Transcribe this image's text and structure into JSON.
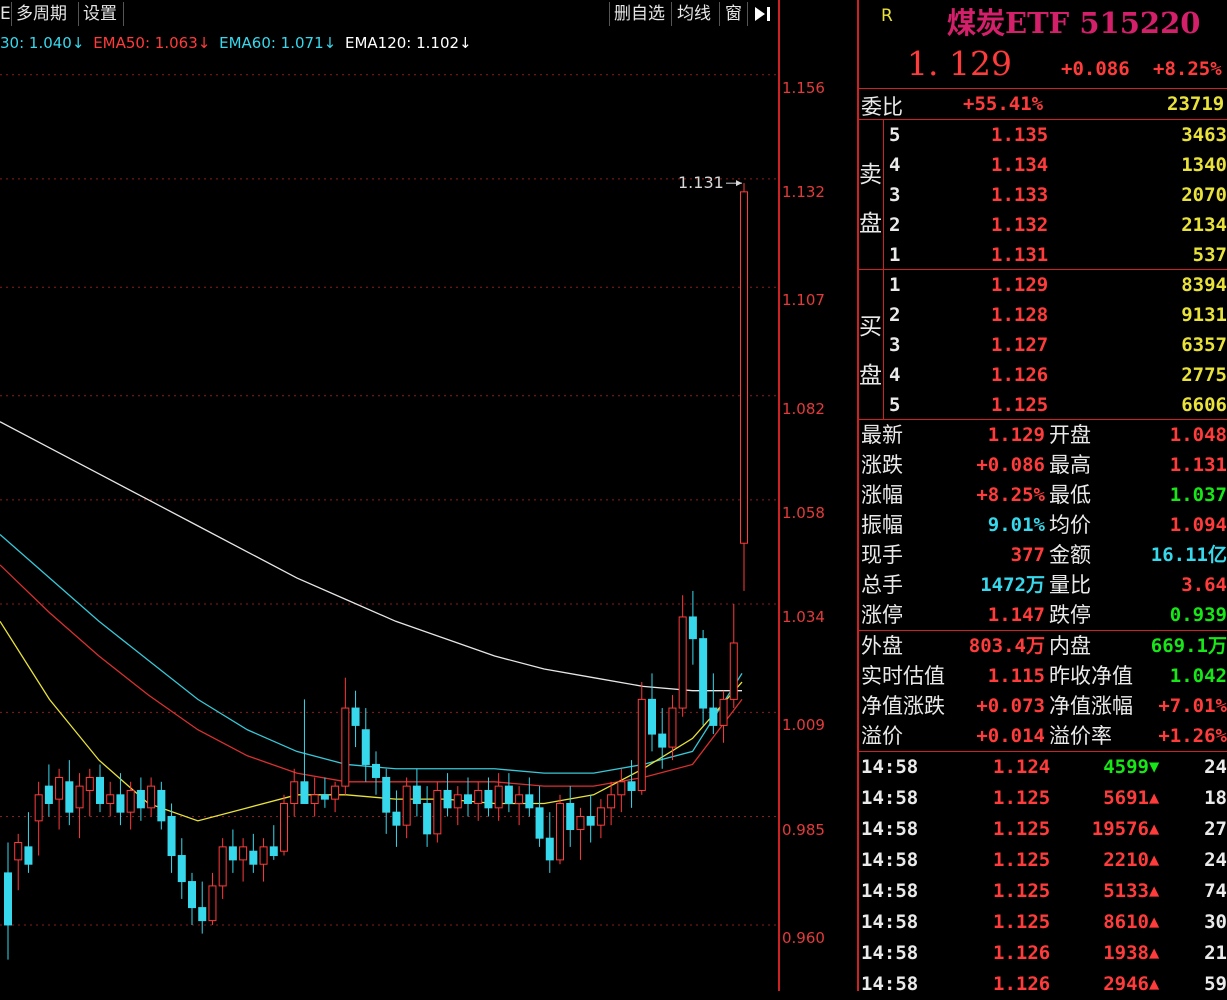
{
  "toolbar": {
    "left_items": [
      "E",
      "多周期",
      "设置"
    ],
    "right_items": [
      "删自选",
      "均线",
      "窗"
    ],
    "collapse_icon": "collapse-right-icon"
  },
  "legend": [
    {
      "text": "30: 1.040↓",
      "color": "#37d8ec"
    },
    {
      "text": "EMA50: 1.063↓",
      "color": "#ff3b3b"
    },
    {
      "text": "EMA60: 1.071↓",
      "color": "#37d8ec"
    },
    {
      "text": "EMA120: 1.102↓",
      "color": "#ffffff"
    }
  ],
  "colors": {
    "up": "#ff3b3b",
    "down": "#37d8ec",
    "ema_white": "#e6e6e6",
    "ema_cyan": "#37c8d8",
    "ema_red": "#d83030",
    "ema_yellow": "#e8e23a",
    "ema_blue": "#3a5ce8",
    "ema_green": "#2aa02a"
  },
  "chart_data": {
    "type": "candlestick",
    "ylim": [
      0.948,
      1.17
    ],
    "y_ticks": [
      "1.156",
      "1.132",
      "1.107",
      "1.082",
      "1.058",
      "1.034",
      "1.009",
      "0.985",
      "0.960"
    ],
    "y_tick_values": [
      1.156,
      1.132,
      1.107,
      1.082,
      1.058,
      1.034,
      1.009,
      0.985,
      0.96
    ],
    "high_marker": "1.131",
    "candles": [
      {
        "o": 0.972,
        "h": 0.979,
        "l": 0.952,
        "c": 0.96
      },
      {
        "o": 0.975,
        "h": 0.981,
        "l": 0.968,
        "c": 0.979
      },
      {
        "o": 0.978,
        "h": 0.986,
        "l": 0.972,
        "c": 0.974
      },
      {
        "o": 0.984,
        "h": 0.993,
        "l": 0.976,
        "c": 0.99
      },
      {
        "o": 0.992,
        "h": 0.997,
        "l": 0.985,
        "c": 0.988
      },
      {
        "o": 0.989,
        "h": 0.996,
        "l": 0.982,
        "c": 0.994
      },
      {
        "o": 0.993,
        "h": 0.998,
        "l": 0.983,
        "c": 0.986
      },
      {
        "o": 0.987,
        "h": 0.995,
        "l": 0.98,
        "c": 0.992
      },
      {
        "o": 0.991,
        "h": 0.996,
        "l": 0.985,
        "c": 0.994
      },
      {
        "o": 0.994,
        "h": 0.997,
        "l": 0.986,
        "c": 0.988
      },
      {
        "o": 0.988,
        "h": 0.993,
        "l": 0.985,
        "c": 0.99
      },
      {
        "o": 0.99,
        "h": 0.995,
        "l": 0.983,
        "c": 0.986
      },
      {
        "o": 0.986,
        "h": 0.993,
        "l": 0.982,
        "c": 0.991
      },
      {
        "o": 0.991,
        "h": 0.994,
        "l": 0.984,
        "c": 0.987
      },
      {
        "o": 0.987,
        "h": 0.994,
        "l": 0.985,
        "c": 0.992
      },
      {
        "o": 0.991,
        "h": 0.993,
        "l": 0.982,
        "c": 0.984
      },
      {
        "o": 0.985,
        "h": 0.988,
        "l": 0.972,
        "c": 0.976
      },
      {
        "o": 0.976,
        "h": 0.98,
        "l": 0.966,
        "c": 0.97
      },
      {
        "o": 0.97,
        "h": 0.972,
        "l": 0.96,
        "c": 0.964
      },
      {
        "o": 0.964,
        "h": 0.97,
        "l": 0.958,
        "c": 0.961
      },
      {
        "o": 0.961,
        "h": 0.972,
        "l": 0.96,
        "c": 0.969
      },
      {
        "o": 0.969,
        "h": 0.98,
        "l": 0.966,
        "c": 0.978
      },
      {
        "o": 0.978,
        "h": 0.982,
        "l": 0.972,
        "c": 0.975
      },
      {
        "o": 0.975,
        "h": 0.98,
        "l": 0.97,
        "c": 0.978
      },
      {
        "o": 0.977,
        "h": 0.981,
        "l": 0.972,
        "c": 0.974
      },
      {
        "o": 0.974,
        "h": 0.98,
        "l": 0.97,
        "c": 0.978
      },
      {
        "o": 0.978,
        "h": 0.983,
        "l": 0.975,
        "c": 0.976
      },
      {
        "o": 0.977,
        "h": 0.99,
        "l": 0.976,
        "c": 0.988
      },
      {
        "o": 0.988,
        "h": 0.996,
        "l": 0.985,
        "c": 0.993
      },
      {
        "o": 0.993,
        "h": 1.012,
        "l": 0.99,
        "c": 0.988
      },
      {
        "o": 0.988,
        "h": 0.994,
        "l": 0.985,
        "c": 0.99
      },
      {
        "o": 0.99,
        "h": 0.994,
        "l": 0.987,
        "c": 0.989
      },
      {
        "o": 0.989,
        "h": 0.993,
        "l": 0.986,
        "c": 0.992
      },
      {
        "o": 0.992,
        "h": 1.017,
        "l": 0.99,
        "c": 1.01
      },
      {
        "o": 1.01,
        "h": 1.014,
        "l": 1.001,
        "c": 1.006
      },
      {
        "o": 1.005,
        "h": 1.01,
        "l": 0.993,
        "c": 0.997
      },
      {
        "o": 0.997,
        "h": 1.0,
        "l": 0.99,
        "c": 0.994
      },
      {
        "o": 0.994,
        "h": 0.996,
        "l": 0.981,
        "c": 0.986
      },
      {
        "o": 0.986,
        "h": 0.991,
        "l": 0.978,
        "c": 0.983
      },
      {
        "o": 0.983,
        "h": 0.994,
        "l": 0.98,
        "c": 0.992
      },
      {
        "o": 0.992,
        "h": 0.996,
        "l": 0.985,
        "c": 0.988
      },
      {
        "o": 0.988,
        "h": 0.992,
        "l": 0.978,
        "c": 0.981
      },
      {
        "o": 0.981,
        "h": 0.993,
        "l": 0.979,
        "c": 0.991
      },
      {
        "o": 0.991,
        "h": 0.995,
        "l": 0.985,
        "c": 0.987
      },
      {
        "o": 0.987,
        "h": 0.992,
        "l": 0.983,
        "c": 0.99
      },
      {
        "o": 0.99,
        "h": 0.994,
        "l": 0.985,
        "c": 0.988
      },
      {
        "o": 0.988,
        "h": 0.993,
        "l": 0.984,
        "c": 0.991
      },
      {
        "o": 0.991,
        "h": 0.994,
        "l": 0.985,
        "c": 0.987
      },
      {
        "o": 0.987,
        "h": 0.995,
        "l": 0.984,
        "c": 0.992
      },
      {
        "o": 0.992,
        "h": 0.995,
        "l": 0.986,
        "c": 0.988
      },
      {
        "o": 0.988,
        "h": 0.992,
        "l": 0.983,
        "c": 0.99
      },
      {
        "o": 0.99,
        "h": 0.994,
        "l": 0.985,
        "c": 0.987
      },
      {
        "o": 0.987,
        "h": 0.992,
        "l": 0.978,
        "c": 0.98
      },
      {
        "o": 0.98,
        "h": 0.986,
        "l": 0.972,
        "c": 0.975
      },
      {
        "o": 0.975,
        "h": 0.99,
        "l": 0.974,
        "c": 0.988
      },
      {
        "o": 0.988,
        "h": 0.992,
        "l": 0.978,
        "c": 0.982
      },
      {
        "o": 0.982,
        "h": 0.987,
        "l": 0.975,
        "c": 0.985
      },
      {
        "o": 0.985,
        "h": 0.99,
        "l": 0.979,
        "c": 0.983
      },
      {
        "o": 0.983,
        "h": 0.989,
        "l": 0.98,
        "c": 0.987
      },
      {
        "o": 0.987,
        "h": 0.993,
        "l": 0.983,
        "c": 0.99
      },
      {
        "o": 0.99,
        "h": 0.996,
        "l": 0.986,
        "c": 0.993
      },
      {
        "o": 0.993,
        "h": 0.998,
        "l": 0.987,
        "c": 0.991
      },
      {
        "o": 0.991,
        "h": 1.016,
        "l": 0.99,
        "c": 1.012
      },
      {
        "o": 1.012,
        "h": 1.018,
        "l": 1.0,
        "c": 1.004
      },
      {
        "o": 1.004,
        "h": 1.01,
        "l": 0.996,
        "c": 1.001
      },
      {
        "o": 1.001,
        "h": 1.013,
        "l": 0.998,
        "c": 1.01
      },
      {
        "o": 1.01,
        "h": 1.036,
        "l": 1.008,
        "c": 1.031
      },
      {
        "o": 1.031,
        "h": 1.037,
        "l": 1.02,
        "c": 1.026
      },
      {
        "o": 1.026,
        "h": 1.028,
        "l": 1.006,
        "c": 1.01
      },
      {
        "o": 1.01,
        "h": 1.018,
        "l": 1.004,
        "c": 1.006
      },
      {
        "o": 1.006,
        "h": 1.014,
        "l": 1.002,
        "c": 1.012
      },
      {
        "o": 1.012,
        "h": 1.034,
        "l": 1.01,
        "c": 1.025
      },
      {
        "o": 1.048,
        "h": 1.131,
        "l": 1.037,
        "c": 1.129
      }
    ],
    "ema_lines": [
      {
        "color_key": "ema_white",
        "values": [
          1.076,
          1.07,
          1.064,
          1.058,
          1.052,
          1.046,
          1.04,
          1.035,
          1.03,
          1.026,
          1.022,
          1.019,
          1.017,
          1.015,
          1.014,
          1.014
        ]
      },
      {
        "color_key": "ema_cyan",
        "values": [
          1.05,
          1.04,
          1.03,
          1.021,
          1.012,
          1.005,
          1.0,
          0.997,
          0.996,
          0.996,
          0.996,
          0.995,
          0.995,
          0.997,
          1.0,
          1.018
        ]
      },
      {
        "color_key": "ema_red",
        "values": [
          1.043,
          1.032,
          1.022,
          1.013,
          1.005,
          0.999,
          0.995,
          0.993,
          0.993,
          0.993,
          0.993,
          0.992,
          0.992,
          0.994,
          0.997,
          1.012
        ]
      },
      {
        "color_key": "ema_yellow",
        "values": [
          1.03,
          1.012,
          0.998,
          0.988,
          0.984,
          0.987,
          0.99,
          0.99,
          0.989,
          0.989,
          0.988,
          0.988,
          0.99,
          0.996,
          1.003,
          1.016
        ]
      }
    ]
  },
  "panel": {
    "badge": "R",
    "title": "煤炭ETF 515220",
    "price": "1. 129",
    "change": "+0.086",
    "change_pct": "+8.25%",
    "weibi_label": "委比",
    "weibi_pct": "+55.41%",
    "weibi_val": "23719",
    "sell_label_1": "卖",
    "sell_label_2": "盘",
    "buy_label_1": "买",
    "buy_label_2": "盘",
    "asks": [
      {
        "lvl": "5",
        "price": "1.135",
        "vol": "3463"
      },
      {
        "lvl": "4",
        "price": "1.134",
        "vol": "1340"
      },
      {
        "lvl": "3",
        "price": "1.133",
        "vol": "2070"
      },
      {
        "lvl": "2",
        "price": "1.132",
        "vol": "2134"
      },
      {
        "lvl": "1",
        "price": "1.131",
        "vol": "537"
      }
    ],
    "bids": [
      {
        "lvl": "1",
        "price": "1.129",
        "vol": "8394"
      },
      {
        "lvl": "2",
        "price": "1.128",
        "vol": "9131"
      },
      {
        "lvl": "3",
        "price": "1.127",
        "vol": "6357"
      },
      {
        "lvl": "4",
        "price": "1.126",
        "vol": "2775"
      },
      {
        "lvl": "5",
        "price": "1.125",
        "vol": "6606"
      }
    ],
    "stats": [
      {
        "l1": "最新",
        "v1": "1.129",
        "c1": "red",
        "l2": "开盘",
        "v2": "1.048",
        "c2": "red"
      },
      {
        "l1": "涨跌",
        "v1": "+0.086",
        "c1": "red",
        "l2": "最高",
        "v2": "1.131",
        "c2": "red"
      },
      {
        "l1": "涨幅",
        "v1": "+8.25%",
        "c1": "red",
        "l2": "最低",
        "v2": "1.037",
        "c2": "green"
      },
      {
        "l1": "振幅",
        "v1": "9.01%",
        "c1": "cyan",
        "l2": "均价",
        "v2": "1.094",
        "c2": "red"
      },
      {
        "l1": "现手",
        "v1": "377",
        "c1": "red",
        "l2": "金额",
        "v2": "16.11亿",
        "c2": "cyan"
      },
      {
        "l1": "总手",
        "v1": "1472万",
        "c1": "cyan",
        "l2": "量比",
        "v2": "3.64",
        "c2": "red"
      },
      {
        "l1": "涨停",
        "v1": "1.147",
        "c1": "red",
        "l2": "跌停",
        "v2": "0.939",
        "c2": "green"
      }
    ],
    "stats2": [
      {
        "l1": "外盘",
        "v1": "803.4万",
        "c1": "red",
        "l2": "内盘",
        "v2": "669.1万",
        "c2": "green"
      },
      {
        "l1": "实时估值",
        "v1": "1.115",
        "c1": "red",
        "l2": "昨收净值",
        "v2": "1.042",
        "c2": "green"
      },
      {
        "l1": "净值涨跌",
        "v1": "+0.073",
        "c1": "red",
        "l2": "净值涨幅",
        "v2": "+7.01%",
        "c2": "red"
      },
      {
        "l1": "溢价",
        "v1": "+0.014",
        "c1": "red",
        "l2": "溢价率",
        "v2": "+1.26%",
        "c2": "red"
      }
    ],
    "ticks": [
      {
        "time": "14:58",
        "price": "1.124",
        "vol": "4599",
        "dir": "down",
        "n": "24"
      },
      {
        "time": "14:58",
        "price": "1.125",
        "vol": "5691",
        "dir": "up",
        "n": "18"
      },
      {
        "time": "14:58",
        "price": "1.125",
        "vol": "19576",
        "dir": "up",
        "n": "27"
      },
      {
        "time": "14:58",
        "price": "1.125",
        "vol": "2210",
        "dir": "up",
        "n": "24"
      },
      {
        "time": "14:58",
        "price": "1.125",
        "vol": "5133",
        "dir": "up",
        "n": "74"
      },
      {
        "time": "14:58",
        "price": "1.125",
        "vol": "8610",
        "dir": "up",
        "n": "30"
      },
      {
        "time": "14:58",
        "price": "1.126",
        "vol": "1938",
        "dir": "up",
        "n": "21"
      },
      {
        "time": "14:58",
        "price": "1.126",
        "vol": "2946",
        "dir": "up",
        "n": "59"
      }
    ]
  }
}
